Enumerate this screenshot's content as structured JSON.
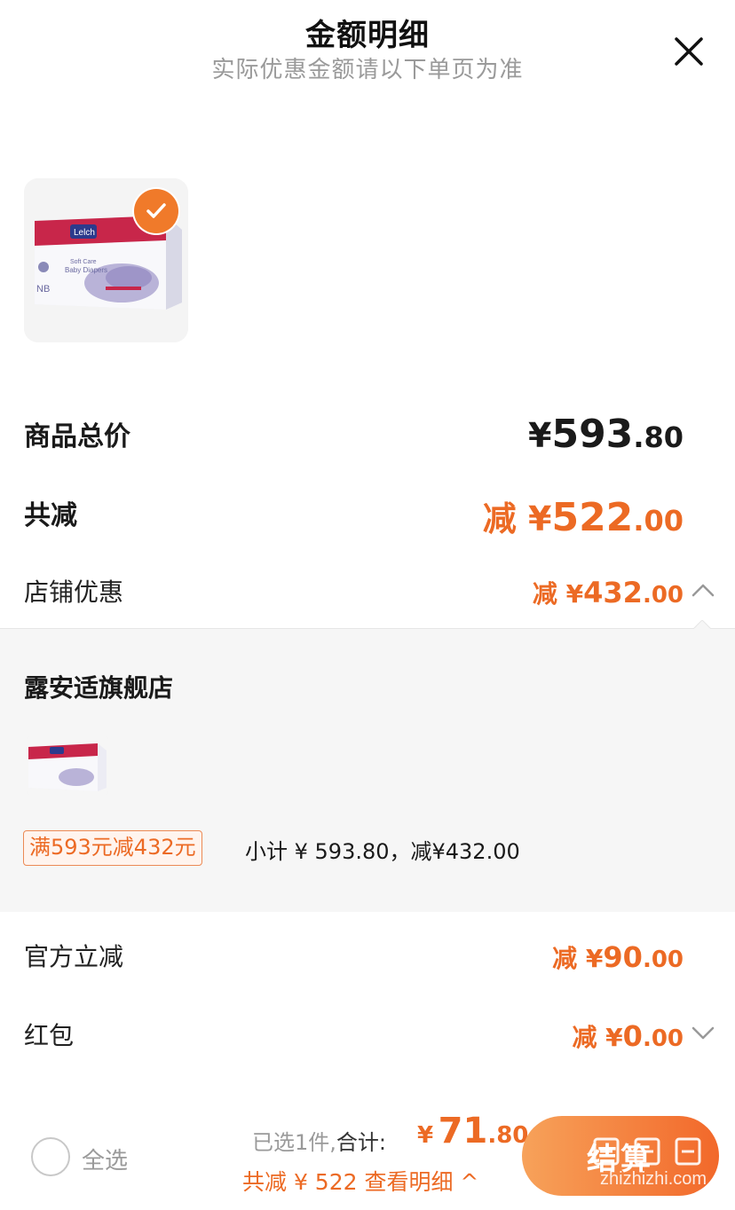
{
  "header": {
    "title": "金额明细",
    "subtitle": "实际优惠金额请以下单页为准"
  },
  "summary": {
    "goods_total_label": "商品总价",
    "goods_total_prefix": "¥",
    "goods_total_int": "593",
    "goods_total_dec": ".80",
    "total_reduce_label": "共减",
    "total_reduce_prefix": "减 ¥",
    "total_reduce_int": "522",
    "total_reduce_dec": ".00",
    "store_discount_label": "店铺优惠",
    "store_discount_prefix": "减 ¥",
    "store_discount_int": "432",
    "store_discount_dec": ".00"
  },
  "store": {
    "name": "露安适旗舰店",
    "promo_tag": "满593元减432元",
    "subtotal": "小计 ¥ 593.80，减¥432.00"
  },
  "discounts": {
    "official_label": "官方立减",
    "official_prefix": "减 ¥",
    "official_int": "90",
    "official_dec": ".00",
    "redpack_label": "红包",
    "redpack_prefix": "减 ¥",
    "redpack_int": "0",
    "redpack_dec": ".00"
  },
  "bottom": {
    "select_all": "全选",
    "selected": "已选1件,",
    "total_label": "合计:",
    "total_prefix": "¥",
    "total_int": "71",
    "total_dec": ".80",
    "reduce_line": "共减 ¥ 522  查看明细 ^",
    "checkout_label": "结算",
    "watermark": "zhizhizhi.com"
  },
  "colors": {
    "accent": "#ec6a24",
    "check_badge": "#f07a2a",
    "panel_bg": "#f6f6f6"
  },
  "icons": {
    "close": "close-icon",
    "check": "check-icon",
    "chevron_up": "chevron-up-icon",
    "chevron_down": "chevron-down-icon"
  }
}
